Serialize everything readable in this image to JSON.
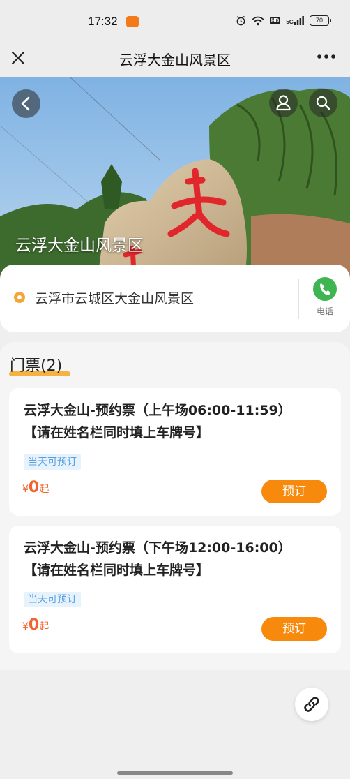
{
  "status_bar": {
    "time": "17:32",
    "signal_label": "5G",
    "hd_label": "HD",
    "battery": "70"
  },
  "nav": {
    "title": "云浮大金山风景区",
    "close_icon": "close-icon",
    "more_icon": "more-icon"
  },
  "hero": {
    "title": "云浮大金山风景区",
    "back_icon": "back-icon",
    "user_icon": "user-icon",
    "search_icon": "search-icon"
  },
  "address": {
    "text": "云浮市云城区大金山风景区",
    "phone_label": "电话",
    "pin_icon": "location-pin-icon",
    "phone_icon": "phone-icon"
  },
  "tickets": {
    "heading": "门票(2)",
    "items": [
      {
        "name_line1": "云浮大金山-预约票（上午场06:00-11:59）",
        "name_line2": "【请在姓名栏同时填上车牌号】",
        "badge": "当天可预订",
        "currency": "¥",
        "price": "0",
        "suffix": "起",
        "book_label": "预订"
      },
      {
        "name_line1": "云浮大金山-预约票（下午场12:00-16:00）",
        "name_line2": "【请在姓名栏同时填上车牌号】",
        "badge": "当天可预订",
        "currency": "¥",
        "price": "0",
        "suffix": "起",
        "book_label": "预订"
      }
    ]
  },
  "fab": {
    "icon": "link-icon"
  },
  "colors": {
    "accent_orange": "#f78a0c",
    "price_red": "#f0642d",
    "badge_blue": "#5aa0e0",
    "phone_green": "#3fb552"
  }
}
